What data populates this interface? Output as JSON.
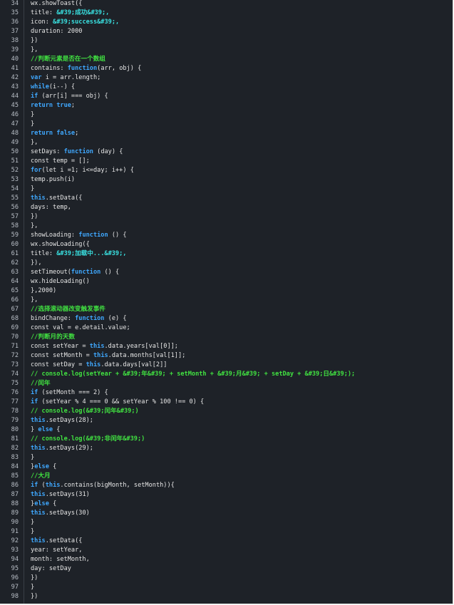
{
  "editor": {
    "lines": [
      {
        "n": "34",
        "segs": [
          [
            "",
            "wx.showToast({"
          ]
        ]
      },
      {
        "n": "35",
        "segs": [
          [
            "",
            "title: "
          ],
          [
            "st",
            "&#39;成功&#39;,"
          ]
        ]
      },
      {
        "n": "36",
        "segs": [
          [
            "",
            "icon: "
          ],
          [
            "st",
            "&#39;success&#39;,"
          ]
        ]
      },
      {
        "n": "37",
        "segs": [
          [
            "",
            "duration: 2000"
          ]
        ]
      },
      {
        "n": "38",
        "segs": [
          [
            "",
            "})"
          ]
        ]
      },
      {
        "n": "39",
        "segs": [
          [
            "",
            "},"
          ]
        ]
      },
      {
        "n": "40",
        "segs": [
          [
            "cm",
            "//判断元素是否在一个数组"
          ]
        ]
      },
      {
        "n": "41",
        "segs": [
          [
            "",
            "contains: "
          ],
          [
            "kw",
            "function"
          ],
          [
            "",
            "(arr, obj) {"
          ]
        ]
      },
      {
        "n": "42",
        "segs": [
          [
            "kw",
            "var"
          ],
          [
            "",
            " i = arr.length;"
          ]
        ]
      },
      {
        "n": "43",
        "segs": [
          [
            "kw",
            "while"
          ],
          [
            "",
            "(i--) {"
          ]
        ]
      },
      {
        "n": "44",
        "segs": [
          [
            "kw",
            "if"
          ],
          [
            "",
            " (arr[i] === obj) {"
          ]
        ]
      },
      {
        "n": "45",
        "segs": [
          [
            "kw",
            "return true"
          ],
          [
            "",
            ";"
          ]
        ]
      },
      {
        "n": "46",
        "segs": [
          [
            "",
            "}"
          ]
        ]
      },
      {
        "n": "47",
        "segs": [
          [
            "",
            "}"
          ]
        ]
      },
      {
        "n": "48",
        "segs": [
          [
            "kw",
            "return false"
          ],
          [
            "",
            ";"
          ]
        ]
      },
      {
        "n": "49",
        "segs": [
          [
            "",
            "},"
          ]
        ]
      },
      {
        "n": "50",
        "segs": [
          [
            "",
            "setDays: "
          ],
          [
            "kw",
            "function"
          ],
          [
            "",
            " (day) {"
          ]
        ]
      },
      {
        "n": "51",
        "segs": [
          [
            "",
            "const temp = [];"
          ]
        ]
      },
      {
        "n": "52",
        "segs": [
          [
            "kw",
            "for"
          ],
          [
            "",
            "(let i =1; i<=day; i++) {"
          ]
        ]
      },
      {
        "n": "53",
        "segs": [
          [
            "",
            "temp.push(i)"
          ]
        ]
      },
      {
        "n": "54",
        "segs": [
          [
            "",
            "}"
          ]
        ]
      },
      {
        "n": "55",
        "segs": [
          [
            "kw",
            "this"
          ],
          [
            "",
            ".setData({"
          ]
        ]
      },
      {
        "n": "56",
        "segs": [
          [
            "",
            "days: temp,"
          ]
        ]
      },
      {
        "n": "57",
        "segs": [
          [
            "",
            "})"
          ]
        ]
      },
      {
        "n": "58",
        "segs": [
          [
            "",
            "},"
          ]
        ]
      },
      {
        "n": "59",
        "segs": [
          [
            "",
            "showLoading: "
          ],
          [
            "kw",
            "function"
          ],
          [
            "",
            " () {"
          ]
        ]
      },
      {
        "n": "60",
        "segs": [
          [
            "",
            "wx.showLoading({"
          ]
        ]
      },
      {
        "n": "61",
        "segs": [
          [
            "",
            "title: "
          ],
          [
            "st",
            "&#39;加载中...&#39;,"
          ]
        ]
      },
      {
        "n": "62",
        "segs": [
          [
            "",
            "}),"
          ]
        ]
      },
      {
        "n": "63",
        "segs": [
          [
            "",
            "setTimeout("
          ],
          [
            "kw",
            "function"
          ],
          [
            "",
            " () {"
          ]
        ]
      },
      {
        "n": "64",
        "segs": [
          [
            "",
            "wx.hideLoading()"
          ]
        ]
      },
      {
        "n": "65",
        "segs": [
          [
            "",
            "},2000)"
          ]
        ]
      },
      {
        "n": "66",
        "segs": [
          [
            "",
            "},"
          ]
        ]
      },
      {
        "n": "67",
        "segs": [
          [
            "cm",
            "//选择滚动器改变触发事件"
          ]
        ]
      },
      {
        "n": "68",
        "segs": [
          [
            "",
            "bindChange: "
          ],
          [
            "kw",
            "function"
          ],
          [
            "",
            " (e) {"
          ]
        ]
      },
      {
        "n": "69",
        "segs": [
          [
            "",
            "const val = e.detail.value;"
          ]
        ]
      },
      {
        "n": "70",
        "segs": [
          [
            "cm",
            "//判断月的天数"
          ]
        ]
      },
      {
        "n": "71",
        "segs": [
          [
            "",
            "const setYear = "
          ],
          [
            "kw",
            "this"
          ],
          [
            "",
            ".data.years[val[0]];"
          ]
        ]
      },
      {
        "n": "72",
        "segs": [
          [
            "",
            "const setMonth = "
          ],
          [
            "kw",
            "this"
          ],
          [
            "",
            ".data.months[val[1]];"
          ]
        ]
      },
      {
        "n": "73",
        "segs": [
          [
            "",
            "const setDay = "
          ],
          [
            "kw",
            "this"
          ],
          [
            "",
            ".data.days[val[2]]"
          ]
        ]
      },
      {
        "n": "74",
        "segs": [
          [
            "cm",
            "// console.log(setYear + &#39;年&#39; + setMonth + &#39;月&#39; + setDay + &#39;日&#39;);"
          ]
        ]
      },
      {
        "n": "75",
        "segs": [
          [
            "cm",
            "//闰年"
          ]
        ]
      },
      {
        "n": "76",
        "segs": [
          [
            "kw",
            "if"
          ],
          [
            "",
            " (setMonth === 2) {"
          ]
        ]
      },
      {
        "n": "77",
        "segs": [
          [
            "kw",
            "if"
          ],
          [
            "",
            " (setYear % 4 === 0 && setYear % 100 !== 0) {"
          ]
        ]
      },
      {
        "n": "78",
        "segs": [
          [
            "cm",
            "// console.log(&#39;闰年&#39;)"
          ]
        ]
      },
      {
        "n": "79",
        "segs": [
          [
            "kw",
            "this"
          ],
          [
            "",
            ".setDays(28);"
          ]
        ]
      },
      {
        "n": "80",
        "segs": [
          [
            "",
            "} "
          ],
          [
            "kw",
            "else"
          ],
          [
            "",
            " {"
          ]
        ]
      },
      {
        "n": "81",
        "segs": [
          [
            "cm",
            "// console.log(&#39;非闰年&#39;)"
          ]
        ]
      },
      {
        "n": "82",
        "segs": [
          [
            "kw",
            "this"
          ],
          [
            "",
            ".setDays(29);"
          ]
        ]
      },
      {
        "n": "83",
        "segs": [
          [
            "",
            "}"
          ]
        ]
      },
      {
        "n": "84",
        "segs": [
          [
            "",
            "}"
          ],
          [
            "kw",
            "else"
          ],
          [
            "",
            " {"
          ]
        ]
      },
      {
        "n": "85",
        "segs": [
          [
            "cm",
            "//大月"
          ]
        ]
      },
      {
        "n": "86",
        "segs": [
          [
            "kw",
            "if"
          ],
          [
            "",
            " ("
          ],
          [
            "kw",
            "this"
          ],
          [
            "",
            ".contains(bigMonth, setMonth)){"
          ]
        ]
      },
      {
        "n": "87",
        "segs": [
          [
            "kw",
            "this"
          ],
          [
            "",
            ".setDays(31)"
          ]
        ]
      },
      {
        "n": "88",
        "segs": [
          [
            "",
            "}"
          ],
          [
            "kw",
            "else"
          ],
          [
            "",
            " {"
          ]
        ]
      },
      {
        "n": "89",
        "segs": [
          [
            "kw",
            "this"
          ],
          [
            "",
            ".setDays(30)"
          ]
        ]
      },
      {
        "n": "90",
        "segs": [
          [
            "",
            "}"
          ]
        ]
      },
      {
        "n": "91",
        "segs": [
          [
            "",
            "}"
          ]
        ]
      },
      {
        "n": "92",
        "segs": [
          [
            "kw",
            "this"
          ],
          [
            "",
            ".setData({"
          ]
        ]
      },
      {
        "n": "93",
        "segs": [
          [
            "",
            "year: setYear,"
          ]
        ]
      },
      {
        "n": "94",
        "segs": [
          [
            "",
            "month: setMonth,"
          ]
        ]
      },
      {
        "n": "95",
        "segs": [
          [
            "",
            "day: setDay"
          ]
        ]
      },
      {
        "n": "96",
        "segs": [
          [
            "",
            "})"
          ]
        ]
      },
      {
        "n": "97",
        "segs": [
          [
            "",
            "}"
          ]
        ]
      },
      {
        "n": "98",
        "segs": [
          [
            "",
            "})"
          ]
        ]
      }
    ]
  }
}
